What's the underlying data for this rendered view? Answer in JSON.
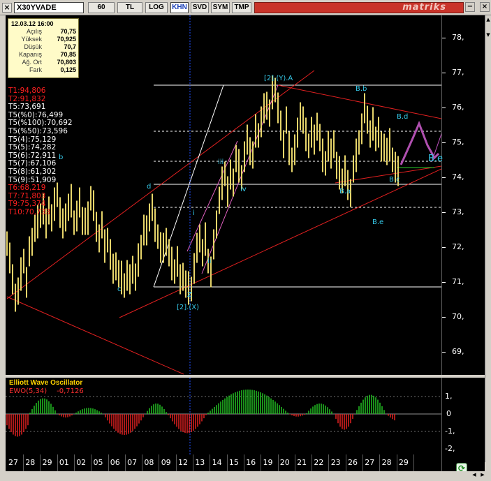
{
  "toolbar": {
    "close_glyph": "×",
    "symbol": "X30YVADE",
    "buttons": [
      {
        "id": "interval",
        "label": "60",
        "active": false
      },
      {
        "id": "tl",
        "label": "TL",
        "active": false
      },
      {
        "id": "log",
        "label": "LOG",
        "active": false
      },
      {
        "id": "khn",
        "label": "KHN",
        "active": true
      },
      {
        "id": "svd",
        "label": "SVD",
        "active": false
      },
      {
        "id": "sym",
        "label": "SYM",
        "active": false
      },
      {
        "id": "tmp",
        "label": "TMP",
        "active": false
      }
    ],
    "brand": "matriks",
    "minimize_glyph": "−",
    "restore_glyph": "▫",
    "close2_glyph": "×"
  },
  "info_panel": {
    "datetime": "12.03.12 16:00",
    "rows": [
      {
        "label": "Açılış",
        "value": "70,75"
      },
      {
        "label": "Yüksek",
        "value": "70,925"
      },
      {
        "label": "Düşük",
        "value": "70,7"
      },
      {
        "label": "Kapanış",
        "value": "70,85"
      },
      {
        "label": "Ağ. Ort",
        "value": "70,803"
      },
      {
        "label": "Fark",
        "value": "0,125"
      }
    ]
  },
  "levels": [
    {
      "text": "T1:94,806",
      "color": "#ff2020"
    },
    {
      "text": "T2:91,832",
      "color": "#ff2020"
    },
    {
      "text": "T5:73,691",
      "color": "#ffffff"
    },
    {
      "text": "T5(%0):76,499",
      "color": "#ffffff"
    },
    {
      "text": "T5(%100):70,692",
      "color": "#ffffff"
    },
    {
      "text": "T5(%50):73,596",
      "color": "#ffffff"
    },
    {
      "text": "T5(4):75,129",
      "color": "#ffffff"
    },
    {
      "text": "T5(5):74,282",
      "color": "#ffffff"
    },
    {
      "text": "T5(6):72,911",
      "color": "#ffffff"
    },
    {
      "text": "T5(7):67,106",
      "color": "#ffffff"
    },
    {
      "text": "T5(8):61,302",
      "color": "#ffffff"
    },
    {
      "text": "T5(9):51,909",
      "color": "#ffffff"
    },
    {
      "text": "T6:68,219",
      "color": "#ff2020"
    },
    {
      "text": "T7:71,803",
      "color": "#ff2020"
    },
    {
      "text": "T9:75,374",
      "color": "#ff2020"
    },
    {
      "text": "T10:70,733",
      "color": "#ff2020"
    }
  ],
  "annotations": [
    {
      "id": "y-a",
      "text": "[2].(Y).A"
    },
    {
      "id": "b-b",
      "text": "B.b"
    },
    {
      "id": "b-d",
      "text": "B.d"
    },
    {
      "id": "b-e-big",
      "text": "B.e"
    },
    {
      "id": "b-c",
      "text": "B.c"
    },
    {
      "id": "b-a",
      "text": "B.a"
    },
    {
      "id": "b-e",
      "text": "B.e"
    },
    {
      "id": "iii",
      "text": "iii"
    },
    {
      "id": "iv",
      "text": "iv"
    },
    {
      "id": "i",
      "text": "i"
    },
    {
      "id": "ii",
      "text": "ii"
    },
    {
      "id": "z",
      "text": "Z"
    },
    {
      "id": "x",
      "text": "[2].(X)"
    },
    {
      "id": "c",
      "text": "c"
    },
    {
      "id": "d",
      "text": "d"
    },
    {
      "id": "b",
      "text": "b"
    }
  ],
  "price_axis": [
    "78,",
    "77,",
    "76,",
    "75,",
    "74,",
    "73,",
    "72,",
    "71,",
    "70,",
    "69,"
  ],
  "oscillator": {
    "title": "Elliott Wave Oscillator",
    "indicator": "EWO(5,34)",
    "value": "-0,7126",
    "axis": [
      "1,",
      "0",
      "-1,",
      "-2,"
    ]
  },
  "dates": [
    "27",
    "28",
    "29",
    "01",
    "02",
    "05",
    "06",
    "07",
    "08",
    "09",
    "12",
    "13",
    "14",
    "15",
    "16",
    "19",
    "20",
    "21",
    "22",
    "23",
    "26",
    "27",
    "28",
    "29"
  ],
  "refresh_glyph": "⟳",
  "scroll_left_glyph": "◀",
  "scroll_right_glyph": "▶",
  "scroll_up_glyph": "▲",
  "scroll_down_glyph": "▼",
  "colors": {
    "background": "#000000",
    "bars": "#e6d46a",
    "channel": "#e02020",
    "forecast": "#b050b0",
    "osc_positive": "#22c022",
    "osc_negative": "#e02020"
  }
}
